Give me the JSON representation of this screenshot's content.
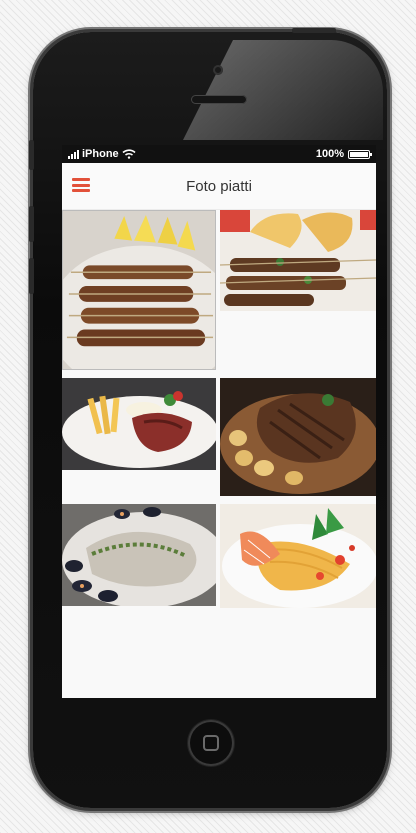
{
  "status_bar": {
    "carrier": "iPhone",
    "battery_text": "100%"
  },
  "header": {
    "title": "Foto piatti",
    "menu_icon": "hamburger-menu-icon"
  },
  "colors": {
    "accent": "#e2513a",
    "status_bar_bg": "#111111",
    "screen_bg": "#f9f9f9"
  },
  "gallery": {
    "photos": [
      {
        "subject": "skewers-with-lemon"
      },
      {
        "subject": "skewers-with-bread"
      },
      {
        "subject": "steak-with-fries"
      },
      {
        "subject": "t-bone-with-potatoes"
      },
      {
        "subject": "fish-with-mussels"
      },
      {
        "subject": "pasta-with-scampi"
      }
    ]
  }
}
